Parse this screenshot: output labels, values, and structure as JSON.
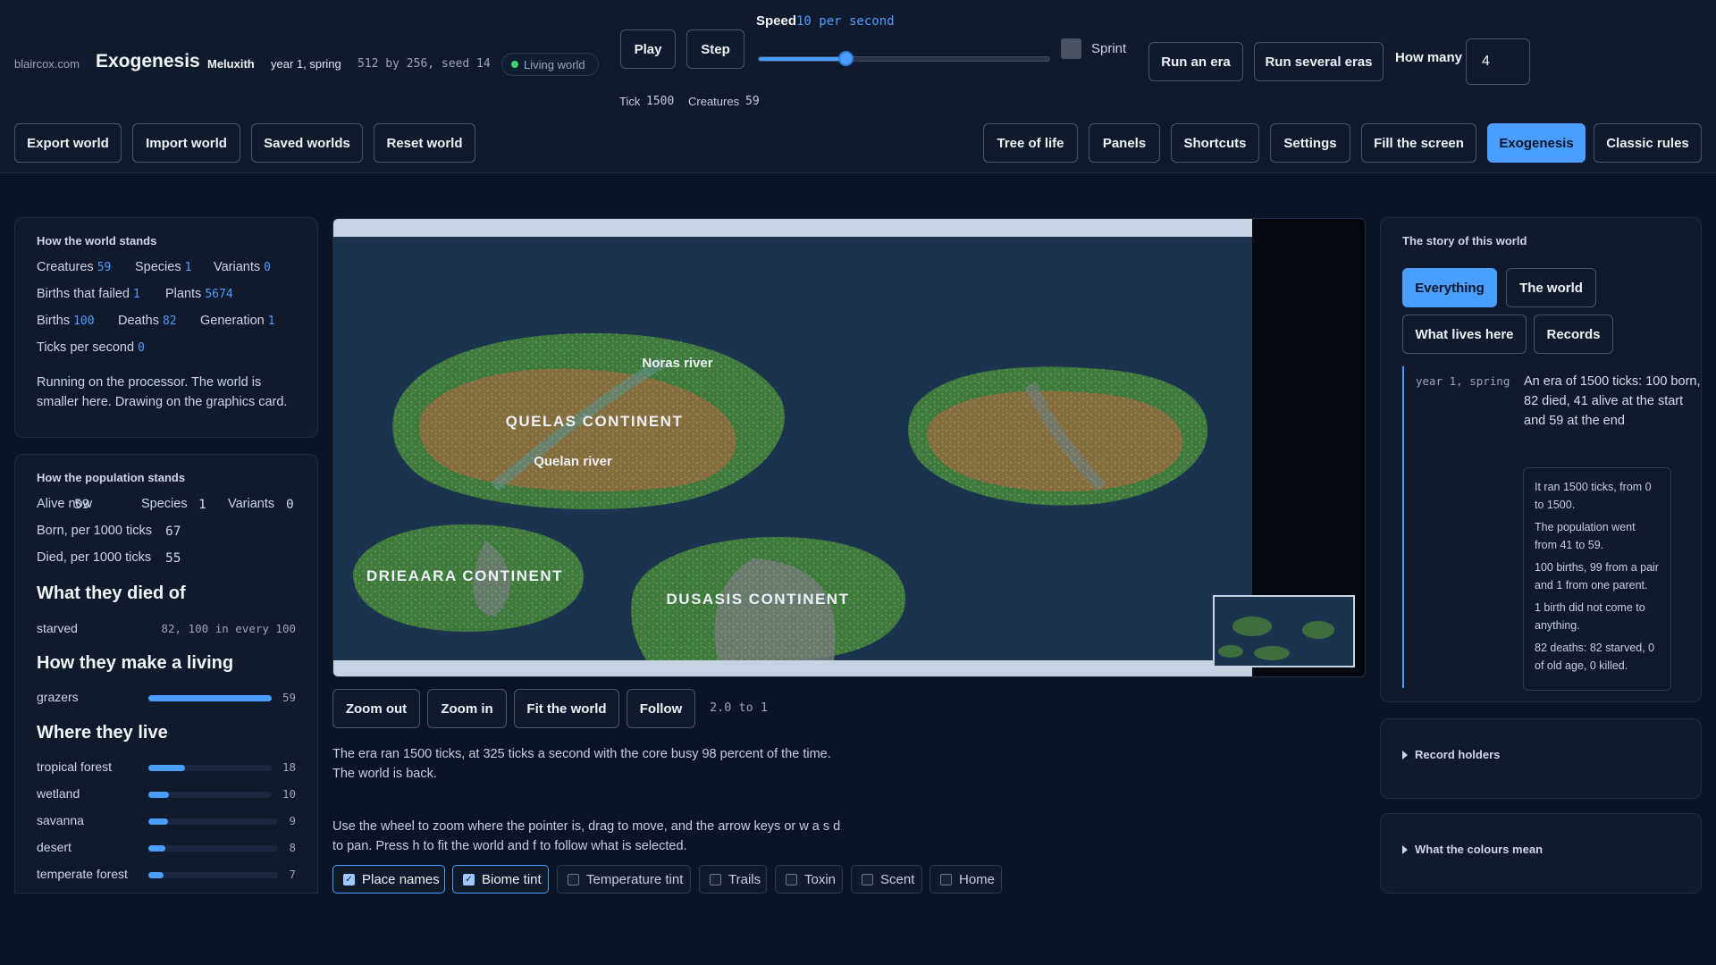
{
  "header": {
    "site": "blaircox.com",
    "title": "Exogenesis",
    "world_name": "Meluxith",
    "season": "year 1, spring",
    "dims": "512 by 256, seed 14",
    "badge": "Living world",
    "play": "Play",
    "step": "Step",
    "speed_label": "Speed",
    "speed_value": "10 per second",
    "speed_level": 0.3,
    "sprint": "Sprint",
    "run_era": "Run an era",
    "run_several": "Run several eras",
    "how_many_label": "How many",
    "how_many_value": "4",
    "tick_label": "Tick",
    "tick_value": "1500",
    "creatures_label": "Creatures",
    "creatures_value": "59"
  },
  "toolbar": {
    "export": "Export world",
    "import": "Import world",
    "saved": "Saved worlds",
    "reset": "Reset world",
    "tree": "Tree of life",
    "panels": "Panels",
    "shortcuts": "Shortcuts",
    "settings": "Settings",
    "fill": "Fill the screen",
    "exogenesis": "Exogenesis",
    "classic": "Classic rules"
  },
  "world_stands": {
    "title": "How the world stands",
    "creatures": {
      "label": "Creatures",
      "value": "59"
    },
    "species": {
      "label": "Species",
      "value": "1"
    },
    "variants": {
      "label": "Variants",
      "value": "0"
    },
    "births_failed": {
      "label": "Births that failed",
      "value": "1"
    },
    "plants": {
      "label": "Plants",
      "value": "5674"
    },
    "births": {
      "label": "Births",
      "value": "100"
    },
    "deaths": {
      "label": "Deaths",
      "value": "82"
    },
    "generation": {
      "label": "Generation",
      "value": "1"
    },
    "ticks_per_second": {
      "label": "Ticks per second",
      "value": "0"
    },
    "note_line1": "Running on the processor. The world is",
    "note_line2": "smaller here. Drawing on the graphics card."
  },
  "population": {
    "title": "How the population stands",
    "alive": {
      "label": "Alive now",
      "value": "59"
    },
    "species": {
      "label": "Species",
      "value": "1"
    },
    "variants": {
      "label": "Variants",
      "value": "0"
    },
    "born": {
      "label": "Born, per 1000 ticks",
      "value": "67"
    },
    "died": {
      "label": "Died, per 1000 ticks",
      "value": "55"
    },
    "died_of_title": "What they died of",
    "died_of": [
      {
        "label": "starved",
        "value": "82, 100 in every 100"
      }
    ],
    "living_title": "How they make a living",
    "living": [
      {
        "label": "grazers",
        "value": "59",
        "fraction": 1.0
      }
    ],
    "where_title": "Where they live",
    "where": [
      {
        "label": "tropical forest",
        "value": "18",
        "fraction": 0.3
      },
      {
        "label": "wetland",
        "value": "10",
        "fraction": 0.17
      },
      {
        "label": "savanna",
        "value": "9",
        "fraction": 0.15
      },
      {
        "label": "desert",
        "value": "8",
        "fraction": 0.13
      },
      {
        "label": "temperate forest",
        "value": "7",
        "fraction": 0.12
      }
    ]
  },
  "map": {
    "labels": {
      "noras": "Noras river",
      "quelas": "QUELAS CONTINENT",
      "quelan": "Quelan river",
      "drieaara": "DRIEAARA CONTINENT",
      "dusasis": "DUSASIS CONTINENT"
    },
    "colors": {
      "ocean": "#1c3350",
      "land_green": "#3e7a3c",
      "land_brown": "#8c6a3c",
      "land_grey": "#6e7a74",
      "border": "#c5d3e3"
    }
  },
  "map_controls": {
    "zoom_out": "Zoom out",
    "zoom_in": "Zoom in",
    "fit": "Fit the world",
    "follow": "Follow",
    "zoom_readout": "2.0 to 1"
  },
  "era_report": {
    "line1": "The era ran 1500 ticks, at 325 ticks a second with the core busy 98 percent of the time.",
    "line2": "The world is back."
  },
  "help": {
    "line1": "Use the wheel to zoom where the pointer is, drag to move, and the arrow keys or w a s d",
    "line2": "to pan. Press h to fit the world and f to follow what is selected."
  },
  "toggles": [
    {
      "label": "Place names",
      "checked": true
    },
    {
      "label": "Biome tint",
      "checked": true
    },
    {
      "label": "Temperature tint",
      "checked": false
    },
    {
      "label": "Trails",
      "checked": false
    },
    {
      "label": "Toxin",
      "checked": false
    },
    {
      "label": "Scent",
      "checked": false
    },
    {
      "label": "Home",
      "checked": false
    }
  ],
  "story": {
    "title": "The story of this world",
    "tabs": {
      "everything": "Everything",
      "world": "The world",
      "lives": "What lives here",
      "records": "Records"
    },
    "date": "year 1, spring",
    "text": "An era of 1500 ticks: 100 born, 82 died, 41 alive at the start and 59 at the end",
    "details": [
      "It ran 1500 ticks, from 0 to 1500.",
      "The population went from 41 to 59.",
      "100 births, 99 from a pair and 1 from one parent.",
      "1 birth did not come to anything.",
      "82 deaths: 82 starved, 0 of old age, 0 killed."
    ]
  },
  "record_holders": "Record holders",
  "colours_mean": "What the colours mean"
}
